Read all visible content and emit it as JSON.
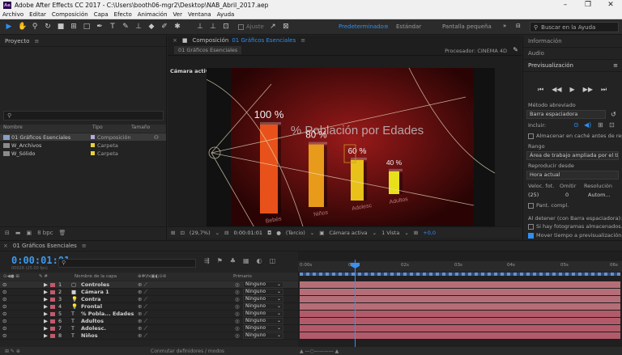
{
  "window": {
    "app_badge": "Ae",
    "title": "Adobe After Effects CC 2017 - C:\\Users\\booth06-mgr2\\Desktop\\NAB_Abril_2017.aep",
    "minimize": "–",
    "maximize": "❐",
    "close": "✕"
  },
  "menu": [
    "Archivo",
    "Editar",
    "Composición",
    "Capa",
    "Efecto",
    "Animación",
    "Ver",
    "Ventana",
    "Ayuda"
  ],
  "toolbar": {
    "align_label": "Ajuste",
    "workspaces": [
      "Predeterminado",
      "Estándar",
      "Pantalla pequeña"
    ],
    "workspace_active": "Predeterminado",
    "workspace_menu": "≡",
    "more": "»",
    "search_placeholder": "Buscar en la Ayuda"
  },
  "project": {
    "title": "Proyecto",
    "menu_glyph": "≡",
    "search_glyph": "⚲",
    "columns": [
      "Nombre",
      "Tipo",
      "Tamaño"
    ],
    "items": [
      {
        "name": "01 Gráficos Esenciales",
        "type": "Composición",
        "size": ""
      },
      {
        "name": "W_Archivos",
        "type": "Carpeta",
        "size": ""
      },
      {
        "name": "W_Sólido",
        "type": "Carpeta",
        "size": ""
      }
    ],
    "footer_bpc": "8 bpc"
  },
  "composition": {
    "panel_title": "Composición",
    "panel_comp_name": "01 Gráficos Esenciales",
    "tab_label": "01 Gráficos Esenciales",
    "renderer_label": "Procesador:",
    "renderer_value": "CINEMA 4D",
    "camera_label": "Cámara activa",
    "footer": {
      "zoom": "(29,7%)",
      "timecode": "0:00:01:01",
      "resolution": "(Tercio)",
      "camera": "Cámara activa",
      "views": "1 Vista",
      "exposure": "+0,0"
    }
  },
  "chart_data": {
    "type": "bar",
    "title": "% Población por Edades",
    "categories": [
      "Bebés",
      "Niños",
      "Adolesc",
      "Adultos"
    ],
    "value_labels": [
      "100 %",
      "80 %",
      "60 %",
      "40 %"
    ],
    "values": [
      100,
      80,
      60,
      40
    ],
    "colors": [
      "#e8521a",
      "#e89a1a",
      "#e8c21a",
      "#e8e01a"
    ],
    "ylim": [
      0,
      100
    ]
  },
  "right_panel": {
    "info_title": "Información",
    "audio_title": "Audio",
    "preview_title": "Previsualización",
    "preview_menu": "≡",
    "method_label": "Método abreviado",
    "method_value": "Barra espaciadora",
    "include_label": "Incluir:",
    "cache_label": "Almacenar en caché antes de reproducir",
    "range_label": "Rango",
    "range_value": "Área de trabajo ampliada por el tiempo actual",
    "play_from_label": "Reproducir desde",
    "play_from_value": "Hora actual",
    "fps_label": "Veloc. fot.",
    "skip_label": "Omitir",
    "res_label": "Resolución",
    "fps_value": "(25)",
    "skip_value": "0",
    "res_value": "Autom...",
    "fullscreen_label": "Pant. compl.",
    "stop_label": "Al detener (con Barra espaciadora):",
    "stop_opt1": "Si hay fotogramas almacenados...",
    "stop_opt2": "Mover tiempo a previsualización"
  },
  "timeline": {
    "tab_label": "01 Gráficos Esenciales",
    "tab_menu": "≡",
    "timecode": "0:00:01:01",
    "timecode_sub": "00026 (25.00 fps)",
    "search_glyph": "⚲",
    "col_layer_name": "Nombre de la capa",
    "col_parent": "Primario",
    "ruler": [
      "0:00s",
      "01s",
      "02s",
      "03s",
      "04s",
      "05s",
      "06s"
    ],
    "layers": [
      {
        "num": "1",
        "name": "Controles",
        "parent": "Ninguno"
      },
      {
        "num": "2",
        "name": "Cámara 1",
        "parent": "Ninguno"
      },
      {
        "num": "3",
        "name": "Contra",
        "parent": "Ninguno"
      },
      {
        "num": "4",
        "name": "Frontal",
        "parent": "Ninguno"
      },
      {
        "num": "5",
        "name": "% Pobla... Edades",
        "parent": "Ninguno"
      },
      {
        "num": "6",
        "name": "Adultos",
        "parent": "Ninguno"
      },
      {
        "num": "7",
        "name": "Adolesc.",
        "parent": "Ninguno"
      },
      {
        "num": "8",
        "name": "Niños",
        "parent": "Ninguno"
      }
    ],
    "footer_toggle": "Conmutar definidores / modos"
  }
}
